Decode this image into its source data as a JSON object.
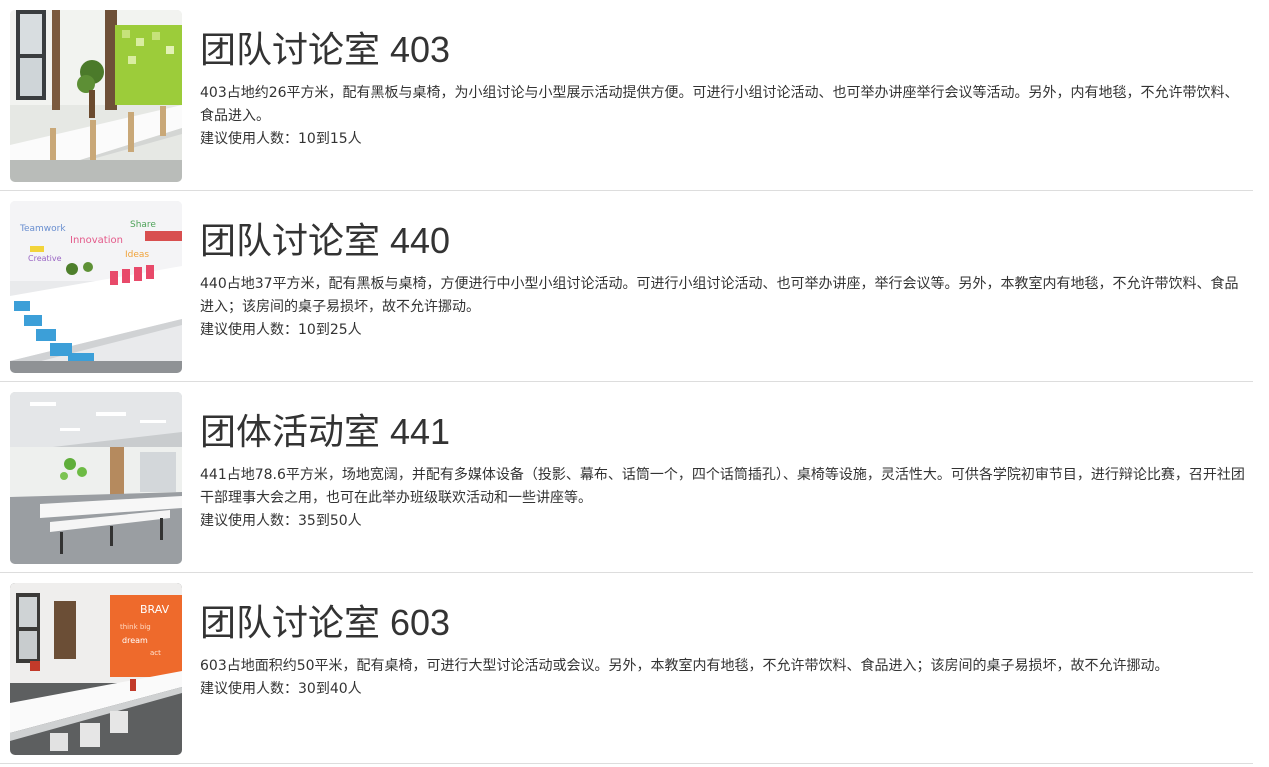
{
  "rooms": [
    {
      "title": "团队讨论室 403",
      "description": "403占地约26平方米，配有黑板与桌椅，为小组讨论与小型展示活动提供方便。可进行小组讨论活动、也可举办讲座举行会议等活动。另外，内有地毯，不允许带饮料、食品进入。",
      "capacity": "建议使用人数：10到15人"
    },
    {
      "title": "团队讨论室 440",
      "description": "440占地37平方米，配有黑板与桌椅，方便进行中小型小组讨论活动。可进行小组讨论活动、也可举办讲座，举行会议等。另外，本教室内有地毯，不允许带饮料、食品进入；该房间的桌子易损坏，故不允许挪动。",
      "capacity": "建议使用人数：10到25人"
    },
    {
      "title": "团体活动室 441",
      "description": "441占地78.6平方米，场地宽阔，并配有多媒体设备（投影、幕布、话筒一个，四个话筒插孔）、桌椅等设施，灵活性大。可供各学院初审节目，进行辩论比赛，召开社团干部理事大会之用，也可在此举办班级联欢活动和一些讲座等。",
      "capacity": "建议使用人数：35到50人"
    },
    {
      "title": "团队讨论室 603",
      "description": "603占地面积约50平米，配有桌椅，可进行大型讨论活动或会议。另外，本教室内有地毯，不允许带饮料、食品进入；该房间的桌子易损坏，故不允许挪动。",
      "capacity": "建议使用人数：30到40人"
    }
  ]
}
